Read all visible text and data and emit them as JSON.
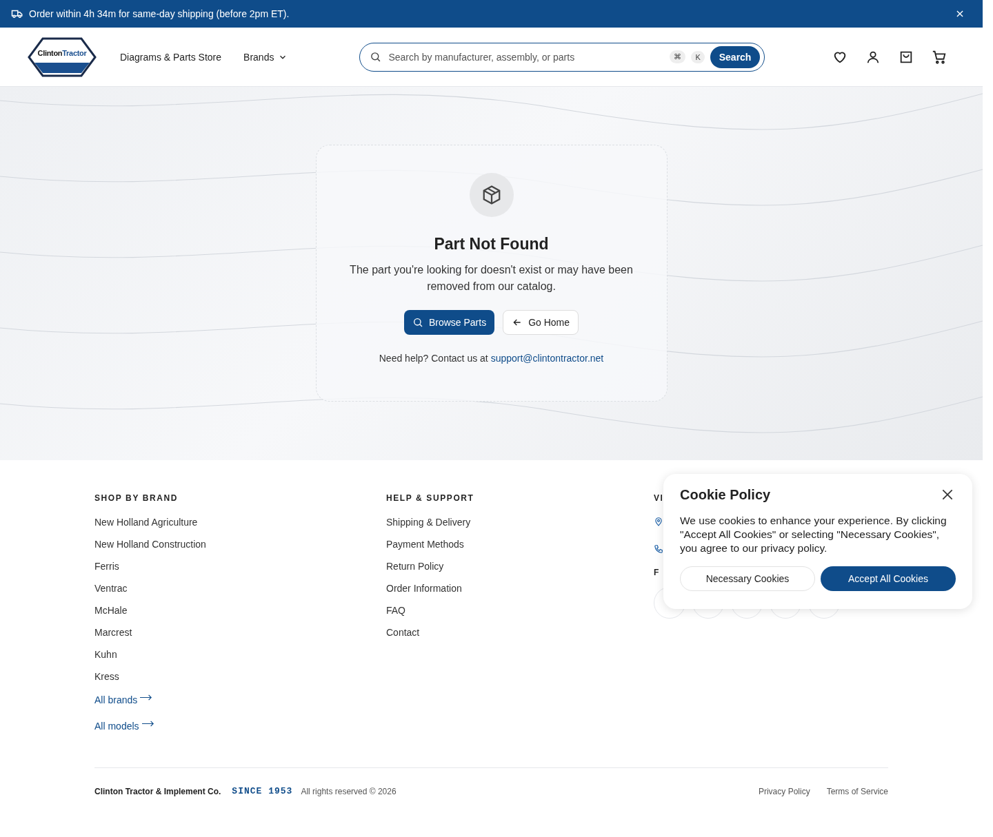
{
  "banner": {
    "text": "Order within 4h 34m for same-day shipping (before 2pm ET)."
  },
  "header": {
    "logo": {
      "word_1": "Clinton",
      "word_2": "Tractor"
    },
    "nav": [
      "Diagrams & Parts Store",
      "Brands"
    ],
    "search": {
      "placeholder": "Search by manufacturer, assembly, or parts",
      "keys": [
        "⌘",
        "K"
      ],
      "button": "Search"
    }
  },
  "not_found": {
    "title": "Part Not Found",
    "message": "The part you're looking for doesn't exist or may have been removed from our catalog.",
    "buttons": [
      {
        "label": "Browse Parts",
        "kind": "primary"
      },
      {
        "label": "Go Home",
        "kind": "secondary"
      }
    ],
    "help_text": "Need help? Contact us at",
    "help_link": "support@clintontractor.net"
  },
  "footer": {
    "columns": [
      {
        "heading": "SHOP BY BRAND",
        "links": [
          "New Holland Agriculture",
          "New Holland Construction",
          "Ferris",
          "Ventrac",
          "McHale",
          "Marcrest",
          "Kuhn",
          "Kress"
        ],
        "more_links": [
          "All brands",
          "All models"
        ]
      },
      {
        "heading": "HELP & SUPPORT",
        "links": [
          "Shipping & Delivery",
          "Payment Methods",
          "Return Policy",
          "Order Information",
          "FAQ",
          "Contact"
        ]
      }
    ],
    "partial_column": {
      "heading_1": "VI",
      "heading_2": "F"
    },
    "company": "Clinton Tractor & Implement Co.",
    "since": "SINCE 1953",
    "rights": "All rights reserved © 2026",
    "legal_links": [
      "Privacy Policy",
      "Terms of Service"
    ]
  },
  "cookie": {
    "title": "Cookie Policy",
    "text": "We use cookies to enhance your experience. By clicking \"Accept All Cookies\" or selecting \"Necessary Cookies\", you agree to our privacy policy.",
    "buttons": [
      {
        "label": "Necessary Cookies",
        "kind": "secondary"
      },
      {
        "label": "Accept All Cookies",
        "kind": "primary"
      }
    ]
  }
}
